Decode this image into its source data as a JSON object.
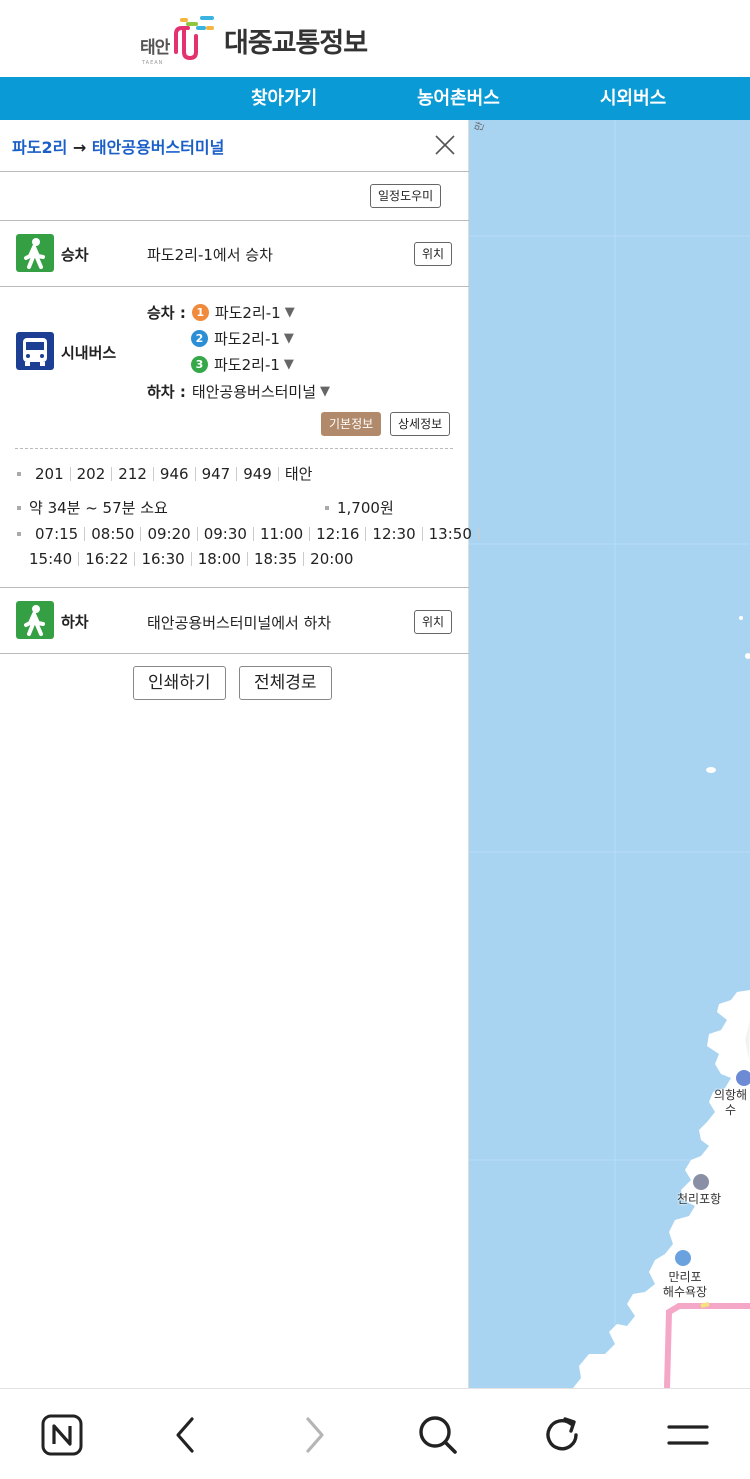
{
  "header": {
    "logo_small": "태안",
    "logo_sub": "TAEAN",
    "logo_title": "대중교통정보"
  },
  "nav": {
    "items": [
      "찾아가기",
      "농어촌버스",
      "시외버스"
    ]
  },
  "panel": {
    "route_from": "파도2리",
    "route_arrow": "→",
    "route_to": "태안공용버스터미널",
    "schedule_helper": "일정도우미",
    "boarding": {
      "label": "승차",
      "text": "파도2리-1에서 승차",
      "location_button": "위치"
    },
    "bus": {
      "label": "시내버스",
      "board_label": "승차 :",
      "board_stops": [
        {
          "num": "1",
          "name": "파도2리-1",
          "color": "#f08a3c"
        },
        {
          "num": "2",
          "name": "파도2리-1",
          "color": "#2c8fd6"
        },
        {
          "num": "3",
          "name": "파도2리-1",
          "color": "#35a84a"
        }
      ],
      "alight_label": "하차 :",
      "alight_stop": "태안공용버스터미널",
      "basic_info_button": "기본정보",
      "detail_info_button": "상세정보",
      "routes": [
        "201",
        "202",
        "212",
        "946",
        "947",
        "949",
        "태안"
      ],
      "duration": "약 34분 ~ 57분 소요",
      "fare": "1,700원",
      "times_row1": [
        "07:15",
        "08:50",
        "09:20",
        "09:30",
        "11:00",
        "12:16",
        "12:30",
        "13:50"
      ],
      "times_row2": [
        "15:40",
        "16:22",
        "16:30",
        "18:00",
        "18:35",
        "20:00"
      ]
    },
    "alighting": {
      "label": "하차",
      "text": "태안공용버스터미널에서 하차",
      "location_button": "위치"
    },
    "print_button": "인쇄하기",
    "full_route_button": "전체경로"
  },
  "map": {
    "labels": [
      {
        "text": "의항해수",
        "line2": ""
      },
      {
        "text": "천리포항",
        "line2": ""
      },
      {
        "text": "만리포",
        "line2": "해수욕장"
      }
    ]
  },
  "colors": {
    "nav": "#0a9ad6",
    "route_title": "#1a5fc8",
    "walk_icon": "#35a043",
    "bus_icon": "#1c3f94",
    "map_water": "#a8d4f2"
  }
}
